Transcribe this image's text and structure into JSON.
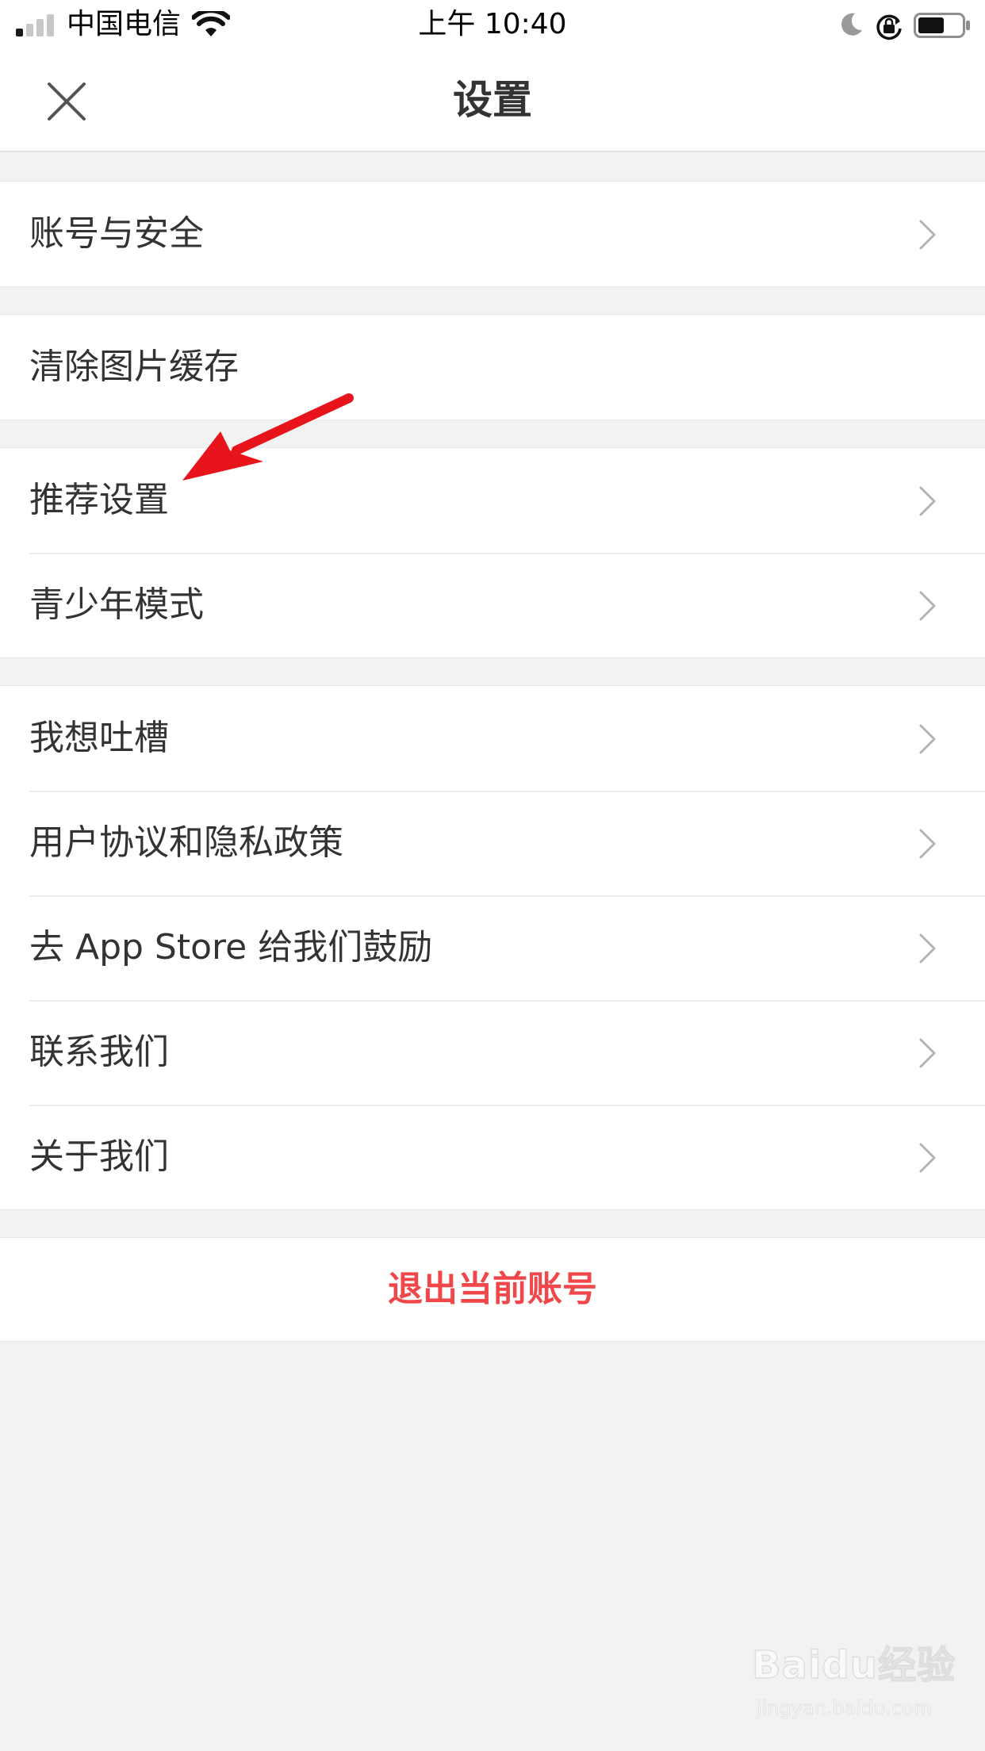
{
  "status_bar": {
    "carrier": "中国电信",
    "time": "上午 10:40",
    "signal_bars_on": 1,
    "signal_bars_total": 4,
    "battery_level": 0.6
  },
  "nav": {
    "title": "设置",
    "close_icon": "close-icon"
  },
  "groups": [
    {
      "items": [
        {
          "label": "账号与安全",
          "chevron": true
        }
      ]
    },
    {
      "items": [
        {
          "label": "清除图片缓存",
          "chevron": false
        }
      ]
    },
    {
      "items": [
        {
          "label": "推荐设置",
          "chevron": true
        },
        {
          "label": "青少年模式",
          "chevron": true
        }
      ]
    },
    {
      "items": [
        {
          "label": "我想吐槽",
          "chevron": true
        },
        {
          "label": "用户协议和隐私政策",
          "chevron": true
        },
        {
          "label": "去 App Store 给我们鼓励",
          "chevron": true
        },
        {
          "label": "联系我们",
          "chevron": true
        },
        {
          "label": "关于我们",
          "chevron": true
        }
      ]
    }
  ],
  "logout": {
    "label": "退出当前账号"
  },
  "watermark": {
    "logo": "Baidu经验",
    "url": "jingyan.baidu.com"
  },
  "colors": {
    "background": "#f2f2f2",
    "surface": "#ffffff",
    "text": "#333333",
    "chevron": "#b3b3b3",
    "logout": "#f0484a",
    "annotation_arrow": "#e8141b"
  }
}
